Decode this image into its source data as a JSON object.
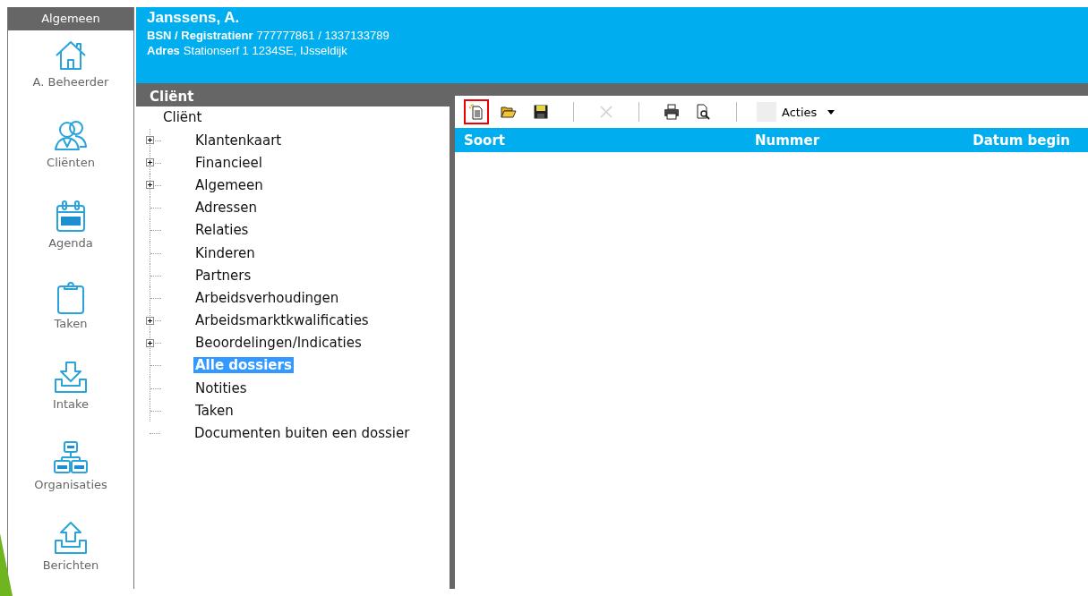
{
  "sidebar": {
    "title": "Algemeen",
    "items": [
      {
        "kind": "home",
        "label": "A. Beheerder"
      },
      {
        "kind": "people",
        "label": "Cliënten"
      },
      {
        "kind": "calendar",
        "label": "Agenda"
      },
      {
        "kind": "clipboard",
        "label": "Taken"
      },
      {
        "kind": "inbox",
        "label": "Intake"
      },
      {
        "kind": "org",
        "label": "Organisaties"
      },
      {
        "kind": "outbox",
        "label": "Berichten"
      }
    ]
  },
  "header": {
    "name": "Janssens, A.",
    "fields": [
      {
        "label": "BSN / Registratienr",
        "value": "777777861 / 1337133789"
      },
      {
        "label": "Adres",
        "value": "Stationserf 1  1234SE, IJsseldijk"
      }
    ]
  },
  "tree": {
    "title": "Cliënt",
    "root": {
      "label": "Cliënt",
      "children": [
        {
          "label": "Klantenkaart",
          "expandable": true,
          "selected": false
        },
        {
          "label": "Financieel",
          "expandable": true,
          "selected": false
        },
        {
          "label": "Algemeen",
          "expandable": true,
          "selected": false
        },
        {
          "label": "Adressen",
          "expandable": false,
          "selected": false
        },
        {
          "label": "Relaties",
          "expandable": false,
          "selected": false
        },
        {
          "label": "Kinderen",
          "expandable": false,
          "selected": false
        },
        {
          "label": "Partners",
          "expandable": false,
          "selected": false
        },
        {
          "label": "Arbeidsverhoudingen",
          "expandable": false,
          "selected": false
        },
        {
          "label": "Arbeidsmarktkwalificaties",
          "expandable": true,
          "selected": false
        },
        {
          "label": "Beoordelingen/Indicaties",
          "expandable": true,
          "selected": false
        },
        {
          "label": "Alle dossiers",
          "expandable": false,
          "selected": true
        },
        {
          "label": "Notities",
          "expandable": false,
          "selected": false
        },
        {
          "label": "Taken",
          "expandable": false,
          "selected": false
        },
        {
          "label": "Documenten buiten een dossier",
          "expandable": false,
          "selected": false
        }
      ]
    }
  },
  "toolbar": [
    {
      "kind": "new",
      "highlighted": true,
      "disabled": false
    },
    {
      "kind": "open",
      "highlighted": false,
      "disabled": false
    },
    {
      "kind": "save",
      "highlighted": false,
      "disabled": false
    },
    {
      "kind": "separator"
    },
    {
      "kind": "delete",
      "highlighted": false,
      "disabled": true
    },
    {
      "kind": "separator"
    },
    {
      "kind": "print",
      "highlighted": false,
      "disabled": false
    },
    {
      "kind": "preview",
      "highlighted": false,
      "disabled": false
    },
    {
      "kind": "separator"
    },
    {
      "kind": "menu",
      "label": "Acties"
    }
  ],
  "table": {
    "columns": [
      "Soort",
      "Nummer",
      "Datum begin"
    ]
  }
}
